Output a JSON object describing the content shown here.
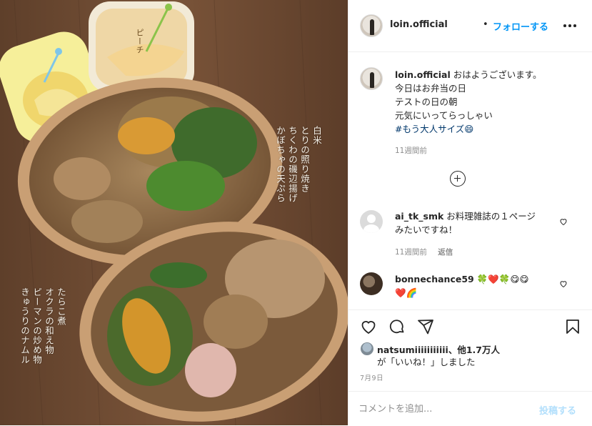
{
  "photo": {
    "caption_top": [
      "白米",
      "とりの照り焼き",
      "ちくわの磯辺揚げ",
      "かぼちゃの天ぷら"
    ],
    "caption_bottom": [
      "たらこ煮",
      "オクラの和え物",
      "ピーマンの炒め物",
      "きゅうりのナムル"
    ],
    "peach_label": "ピーチ"
  },
  "header": {
    "username": "loin.official",
    "separator": "•",
    "follow_label": "フォローする"
  },
  "post": {
    "username": "loin.official",
    "lines": [
      "おはようございます。",
      "今日はお弁当の日",
      "テストの日の朝",
      "元気にいってらっしゃい"
    ],
    "hashtag": "#もう大人サイズ😄",
    "time": "11週間前"
  },
  "comments": [
    {
      "username": "ai_tk_smk",
      "text_line1": "お料理雑誌の１ページ",
      "text_line2": "みたいですね！",
      "time": "11週間前",
      "reply_label": "返信"
    },
    {
      "username": "bonnechance59",
      "text_line1": "🍀❤️🍀😋😋",
      "text_line2": "❤️🌈"
    }
  ],
  "likes": {
    "user": "natsumiiiiiiiiiii",
    "others": "、他1.7万人",
    "line2": "が「いいね！」しました"
  },
  "date": "7月9日",
  "composer": {
    "placeholder": "コメントを追加...",
    "post_label": "投稿する"
  },
  "colors": {
    "link": "#0095f6",
    "post_button_disabled": "#b2dffc",
    "hashtag": "#00376b",
    "muted": "#8e8e8e"
  },
  "icons": [
    "more-icon",
    "plus-circle-icon",
    "heart-icon",
    "comment-icon",
    "share-icon",
    "bookmark-icon"
  ]
}
